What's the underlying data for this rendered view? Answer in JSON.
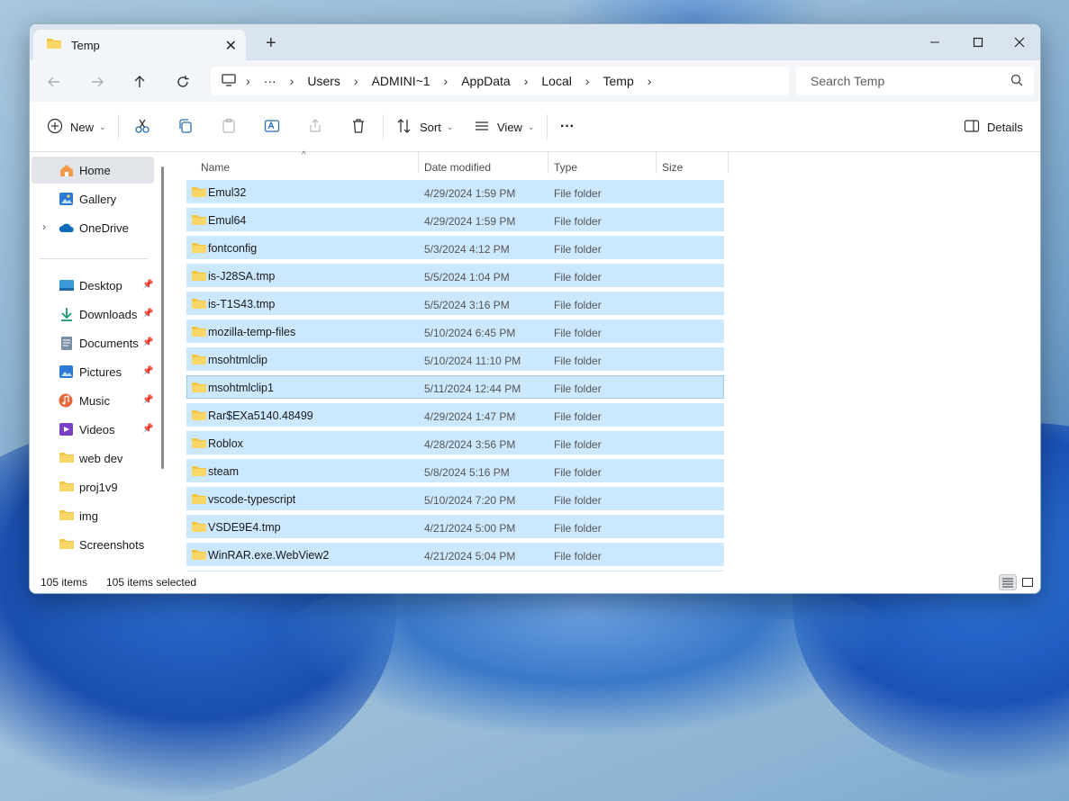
{
  "window": {
    "tab_title": "Temp",
    "tab_close": "✕",
    "new_tab": "+",
    "controls": {
      "minimize": "minimize-icon",
      "maximize": "maximize-icon",
      "close": "close-icon"
    }
  },
  "address": {
    "breadcrumbs": [
      "Users",
      "ADMINI~1",
      "AppData",
      "Local",
      "Temp"
    ],
    "more": "···",
    "search_placeholder": "Search Temp"
  },
  "toolbar": {
    "new_label": "New",
    "sort_label": "Sort",
    "view_label": "View",
    "more_label": "···",
    "details_label": "Details"
  },
  "sidebar": {
    "home": "Home",
    "gallery": "Gallery",
    "onedrive": "OneDrive",
    "quick": [
      {
        "label": "Desktop",
        "pinned": true
      },
      {
        "label": "Downloads",
        "pinned": true
      },
      {
        "label": "Documents",
        "pinned": true
      },
      {
        "label": "Pictures",
        "pinned": true
      },
      {
        "label": "Music",
        "pinned": true
      },
      {
        "label": "Videos",
        "pinned": true
      },
      {
        "label": "web dev",
        "pinned": false
      },
      {
        "label": "proj1v9",
        "pinned": false
      },
      {
        "label": "img",
        "pinned": false
      },
      {
        "label": "Screenshots",
        "pinned": false
      }
    ]
  },
  "columns": {
    "name": "Name",
    "date": "Date modified",
    "type": "Type",
    "size": "Size"
  },
  "files": [
    {
      "name": "Emul32",
      "date": "4/29/2024 1:59 PM",
      "type": "File folder"
    },
    {
      "name": "Emul64",
      "date": "4/29/2024 1:59 PM",
      "type": "File folder"
    },
    {
      "name": "fontconfig",
      "date": "5/3/2024 4:12 PM",
      "type": "File folder"
    },
    {
      "name": "is-J28SA.tmp",
      "date": "5/5/2024 1:04 PM",
      "type": "File folder"
    },
    {
      "name": "is-T1S43.tmp",
      "date": "5/5/2024 3:16 PM",
      "type": "File folder"
    },
    {
      "name": "mozilla-temp-files",
      "date": "5/10/2024 6:45 PM",
      "type": "File folder"
    },
    {
      "name": "msohtmlclip",
      "date": "5/10/2024 11:10 PM",
      "type": "File folder"
    },
    {
      "name": "msohtmlclip1",
      "date": "5/11/2024 12:44 PM",
      "type": "File folder"
    },
    {
      "name": "Rar$EXa5140.48499",
      "date": "4/29/2024 1:47 PM",
      "type": "File folder"
    },
    {
      "name": "Roblox",
      "date": "4/28/2024 3:56 PM",
      "type": "File folder"
    },
    {
      "name": "steam",
      "date": "5/8/2024 5:16 PM",
      "type": "File folder"
    },
    {
      "name": "vscode-typescript",
      "date": "5/10/2024 7:20 PM",
      "type": "File folder"
    },
    {
      "name": "VSDE9E4.tmp",
      "date": "4/21/2024 5:00 PM",
      "type": "File folder"
    },
    {
      "name": "WinRAR.exe.WebView2",
      "date": "4/21/2024 5:04 PM",
      "type": "File folder"
    }
  ],
  "status": {
    "items": "105 items",
    "selected": "105 items selected"
  },
  "colors": {
    "selection": "#cce8ff",
    "folder": "#f4c542",
    "accent": "#0067c0"
  }
}
